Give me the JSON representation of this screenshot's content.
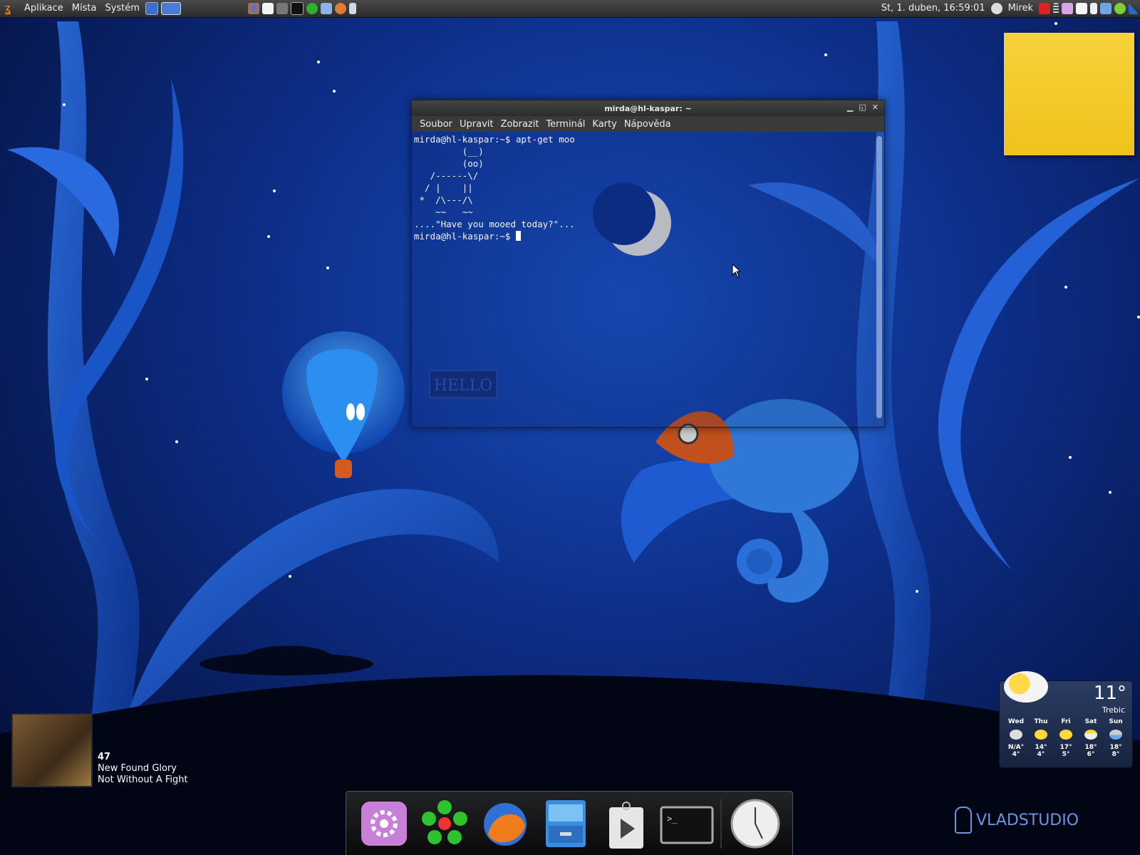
{
  "top_panel": {
    "menus": [
      "Aplikace",
      "Místa",
      "Systém"
    ],
    "clock": "St,  1. duben, 16:59:01",
    "user": "Mirek"
  },
  "terminal": {
    "title": "mirda@hl-kaspar: ~",
    "menus": [
      "Soubor",
      "Upravit",
      "Zobrazit",
      "Terminál",
      "Karty",
      "Nápověda"
    ],
    "lines": [
      "mirda@hl-kaspar:~$ apt-get moo",
      "         (__)",
      "         (oo)",
      "   /------\\/",
      "  / |    ||",
      " *  /\\---/\\",
      "    ~~   ~~",
      "....\"Have you mooed today?\"...",
      "mirda@hl-kaspar:~$ "
    ]
  },
  "now_playing": {
    "track_number": "47",
    "artist": "New Found Glory",
    "album": "Not Without A Fight"
  },
  "weather": {
    "temperature": "11°",
    "city": "Trebic",
    "forecast": [
      {
        "day": "Wed",
        "high": "N/A°",
        "low": "4°"
      },
      {
        "day": "Thu",
        "high": "14°",
        "low": "4°"
      },
      {
        "day": "Fri",
        "high": "17°",
        "low": "5°"
      },
      {
        "day": "Sat",
        "high": "18°",
        "low": "6°"
      },
      {
        "day": "Sun",
        "high": "18°",
        "low": "8°"
      }
    ]
  },
  "branding": "VLADSTUDIO",
  "colors": {
    "panel": "#333333",
    "sticky_note": "#f3c926",
    "terminal_text": "#f5f5f5",
    "desktop_blue": "#0d2f8a"
  }
}
